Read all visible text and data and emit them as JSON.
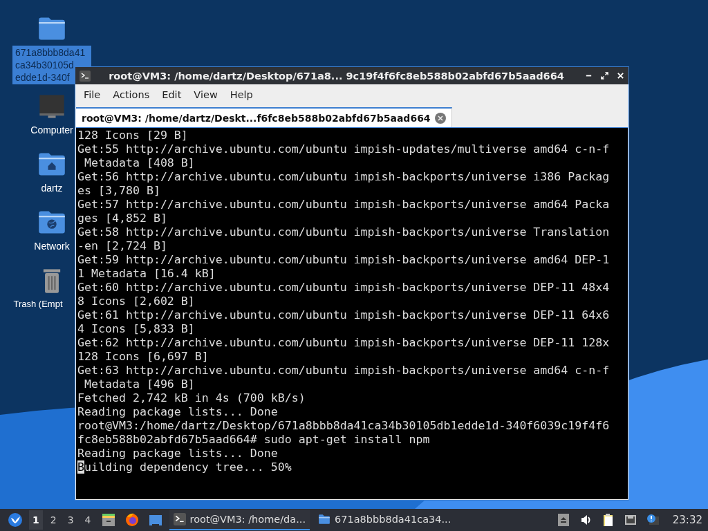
{
  "desktop_icons": [
    {
      "kind": "folder",
      "label": [
        "671a8bbb8da41",
        "ca34b30105d",
        "edde1d-340f"
      ],
      "selected": true
    },
    {
      "kind": "computer",
      "label": [
        "Computer"
      ],
      "selected": false
    },
    {
      "kind": "home",
      "label": [
        "dartz"
      ],
      "selected": false
    },
    {
      "kind": "network",
      "label": [
        "Network"
      ],
      "selected": false
    },
    {
      "kind": "trash",
      "label": [
        "Trash (Empt"
      ],
      "selected": false
    }
  ],
  "window": {
    "title": "root@VM3: /home/dartz/Desktop/671a8... 9c19f4f6fc8eb588b02abfd67b5aad664",
    "menu": [
      "File",
      "Actions",
      "Edit",
      "View",
      "Help"
    ],
    "tabs": [
      {
        "label": "root@VM3: /home/dartz/Deskt...f6fc8eb588b02abfd67b5aad664",
        "selected": true
      }
    ],
    "terminal_lines": [
      {
        "text": "128 Icons [29 B]"
      },
      {
        "text": "Get:55 http://archive.ubuntu.com/ubuntu impish-updates/multiverse amd64 c-n-f"
      },
      {
        "text": " Metadata [408 B]"
      },
      {
        "text": "Get:56 http://archive.ubuntu.com/ubuntu impish-backports/universe i386 Packag"
      },
      {
        "text": "es [3,780 B]"
      },
      {
        "text": "Get:57 http://archive.ubuntu.com/ubuntu impish-backports/universe amd64 Packa"
      },
      {
        "text": "ges [4,852 B]"
      },
      {
        "text": "Get:58 http://archive.ubuntu.com/ubuntu impish-backports/universe Translation"
      },
      {
        "text": "-en [2,724 B]"
      },
      {
        "text": "Get:59 http://archive.ubuntu.com/ubuntu impish-backports/universe amd64 DEP-1"
      },
      {
        "text": "1 Metadata [16.4 kB]"
      },
      {
        "text": "Get:60 http://archive.ubuntu.com/ubuntu impish-backports/universe DEP-11 48x4"
      },
      {
        "text": "8 Icons [2,602 B]"
      },
      {
        "text": "Get:61 http://archive.ubuntu.com/ubuntu impish-backports/universe DEP-11 64x6"
      },
      {
        "text": "4 Icons [5,833 B]"
      },
      {
        "text": "Get:62 http://archive.ubuntu.com/ubuntu impish-backports/universe DEP-11 128x"
      },
      {
        "text": "128 Icons [6,697 B]"
      },
      {
        "text": "Get:63 http://archive.ubuntu.com/ubuntu impish-backports/universe amd64 c-n-f"
      },
      {
        "text": " Metadata [496 B]"
      },
      {
        "text": "Fetched 2,742 kB in 4s (700 kB/s)"
      },
      {
        "text": "Reading package lists... Done"
      },
      {
        "text": "root@VM3:/home/dartz/Desktop/671a8bbb8da41ca34b30105db1edde1d-340f6039c19f4f6"
      },
      {
        "text": "fc8eb588b02abfd67b5aad664# sudo apt-get install npm"
      },
      {
        "text": "Reading package lists... Done"
      },
      {
        "text": "Building dependency tree... 50%",
        "cursor": true
      }
    ]
  },
  "taskbar": {
    "workspaces": [
      {
        "label": "1",
        "selected": true
      },
      {
        "label": "2",
        "selected": false
      },
      {
        "label": "3",
        "selected": false
      },
      {
        "label": "4",
        "selected": false
      }
    ],
    "launchers": [
      {
        "kind": "files"
      },
      {
        "kind": "browser"
      },
      {
        "kind": "desktop"
      }
    ],
    "tasks": [
      {
        "kind": "terminal",
        "label": "root@VM3: /home/da...",
        "selected": true
      },
      {
        "kind": "folder",
        "label": "671a8bbb8da41ca34...",
        "selected": false
      }
    ],
    "tray": [
      {
        "kind": "eject"
      },
      {
        "kind": "volume"
      },
      {
        "kind": "clipboard"
      },
      {
        "kind": "network"
      },
      {
        "kind": "update"
      }
    ],
    "clock": "23:32"
  }
}
